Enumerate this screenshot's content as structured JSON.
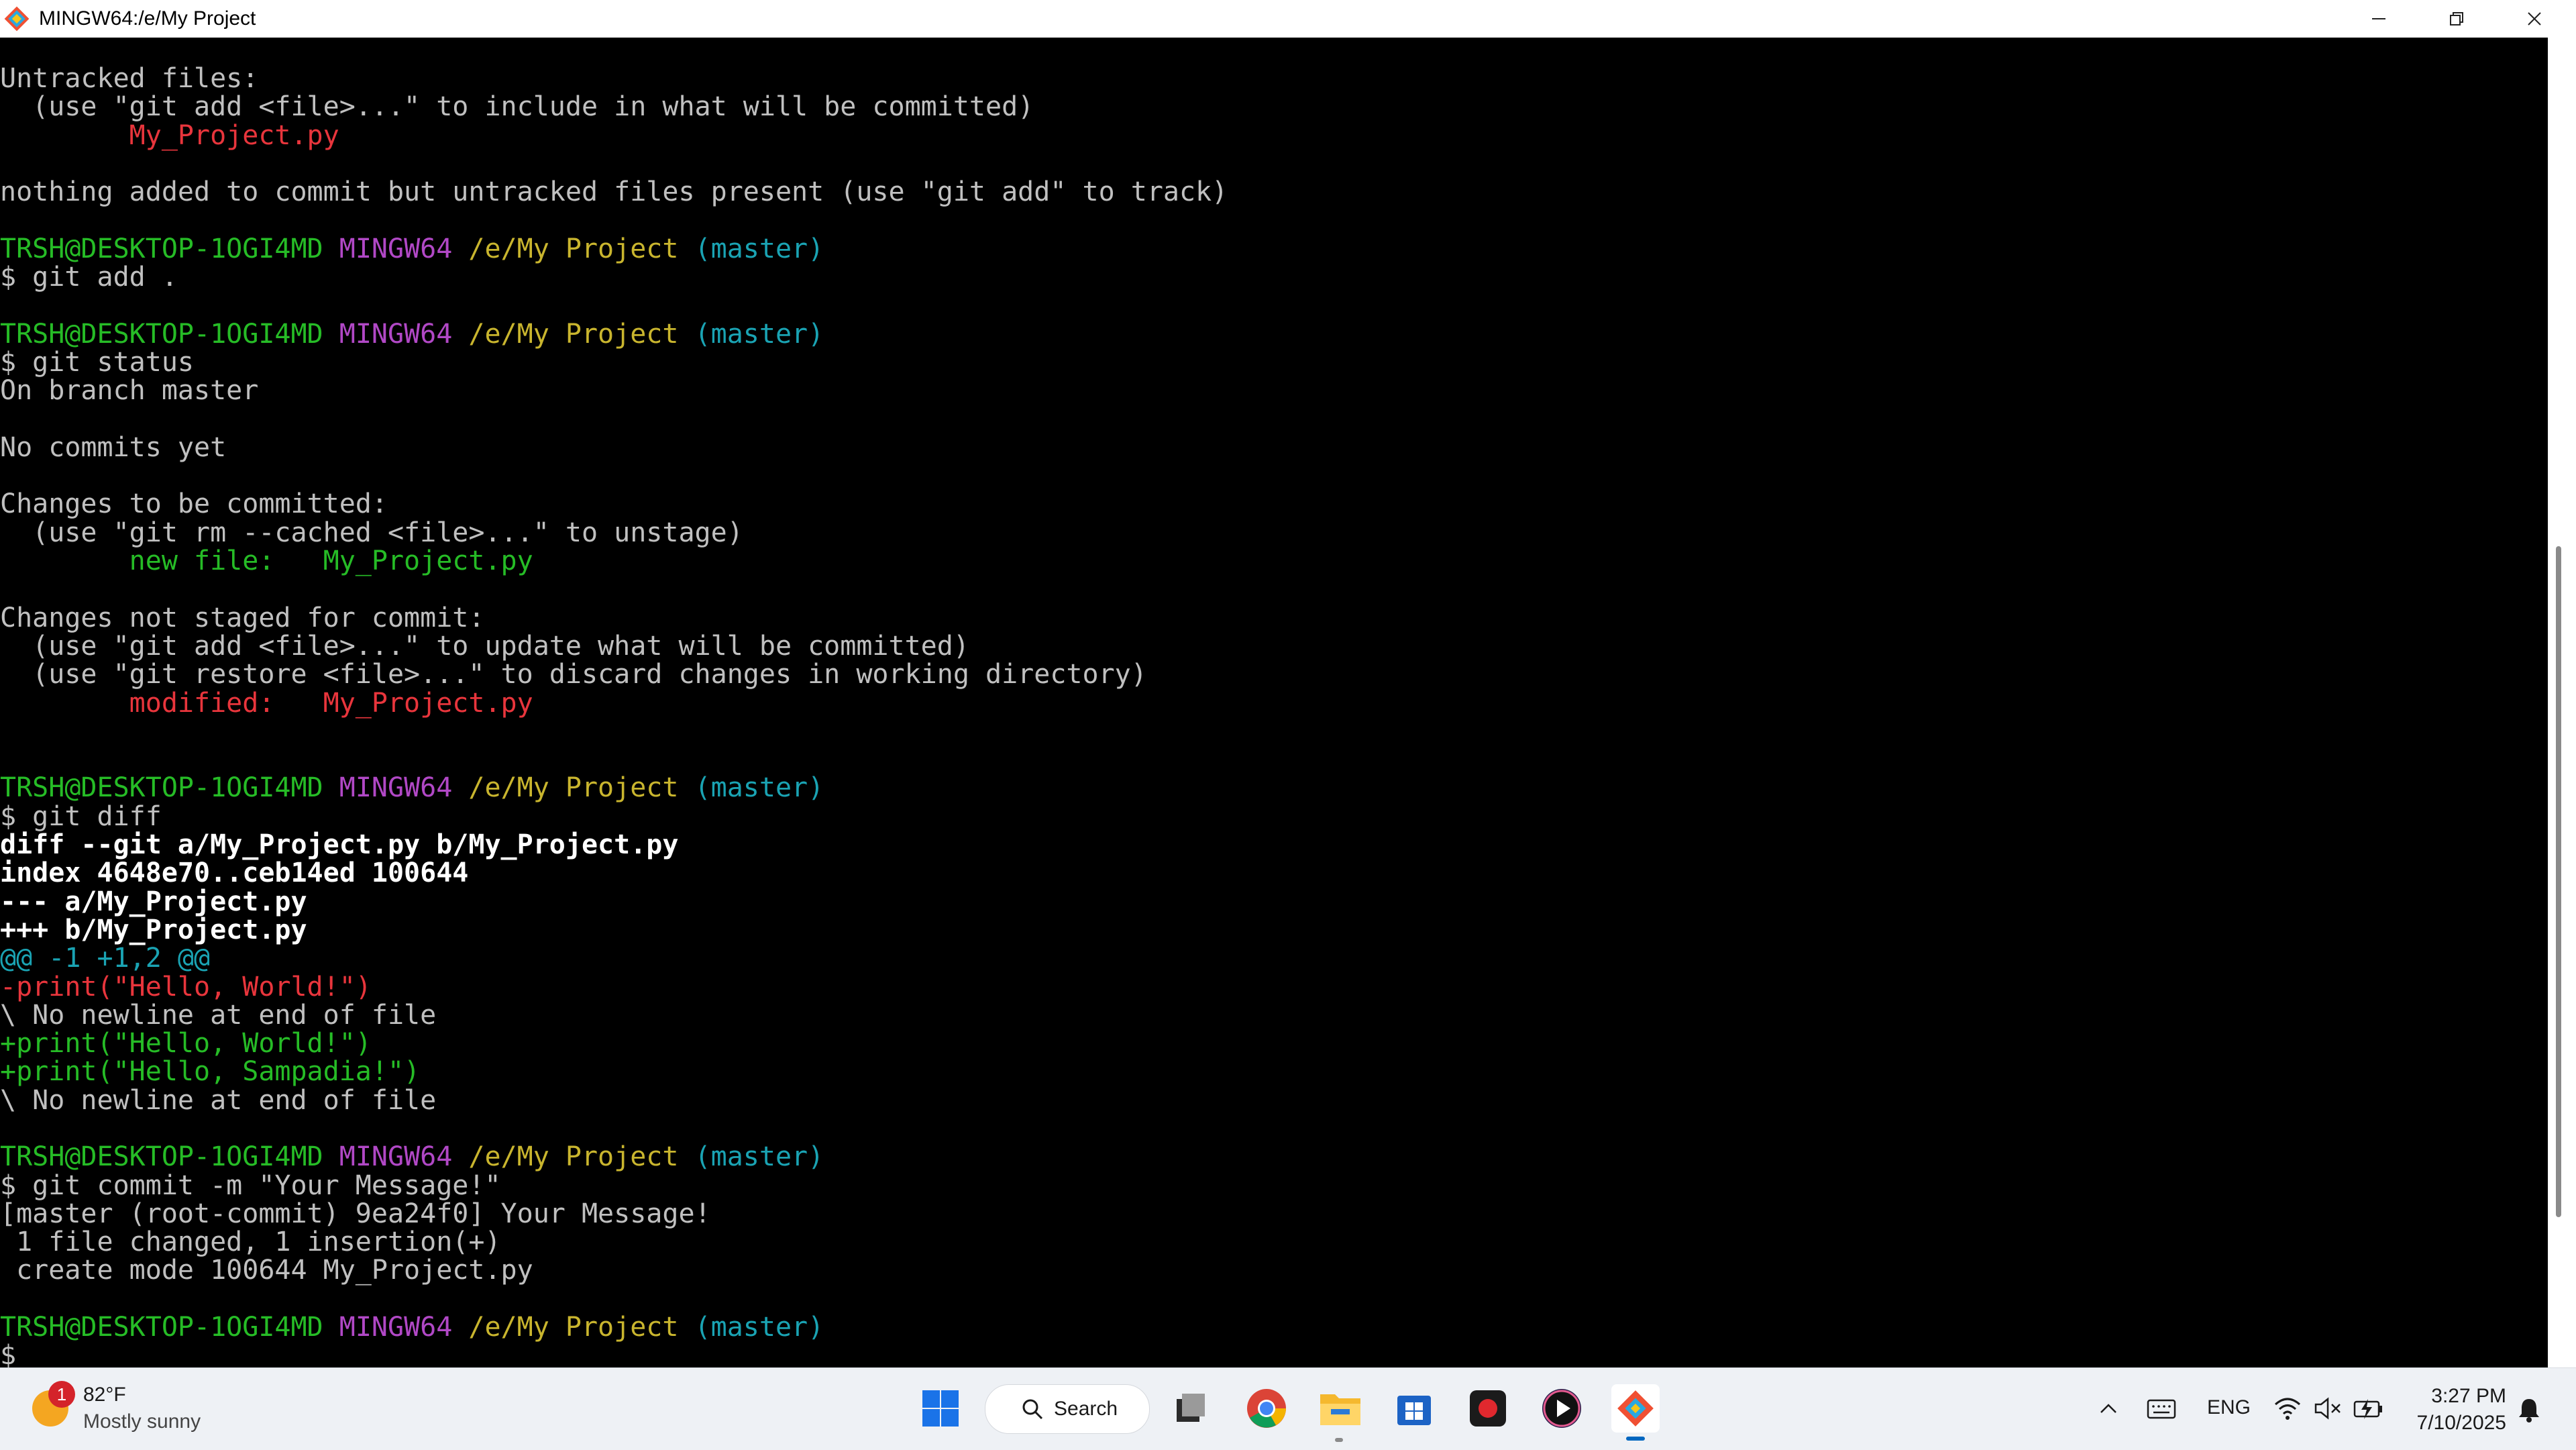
{
  "window": {
    "title": "MINGW64:/e/My Project"
  },
  "colors": {
    "green": "#26bc26",
    "red": "#e8353c",
    "magenta": "#b148c6",
    "yellow": "#c9b52e",
    "cyan": "#1aa3b3"
  },
  "terminal": {
    "lines": [
      [
        {
          "t": "Untracked files:",
          "c": "normal"
        }
      ],
      [
        {
          "t": "  (use \"git add <file>...\" to include in what will be committed)",
          "c": "normal"
        }
      ],
      [
        {
          "t": "        My_Project.py",
          "c": "red"
        }
      ],
      [],
      [
        {
          "t": "nothing added to commit but untracked files present (use \"git add\" to track)",
          "c": "normal"
        }
      ],
      [],
      [
        {
          "t": "TRSH@DESKTOP-1OGI4MD ",
          "c": "green"
        },
        {
          "t": "MINGW64 ",
          "c": "magenta"
        },
        {
          "t": "/e/My Project ",
          "c": "yellow"
        },
        {
          "t": "(master)",
          "c": "cyan"
        }
      ],
      [
        {
          "t": "$ git add .",
          "c": "normal"
        }
      ],
      [],
      [
        {
          "t": "TRSH@DESKTOP-1OGI4MD ",
          "c": "green"
        },
        {
          "t": "MINGW64 ",
          "c": "magenta"
        },
        {
          "t": "/e/My Project ",
          "c": "yellow"
        },
        {
          "t": "(master)",
          "c": "cyan"
        }
      ],
      [
        {
          "t": "$ git status",
          "c": "normal"
        }
      ],
      [
        {
          "t": "On branch master",
          "c": "normal"
        }
      ],
      [],
      [
        {
          "t": "No commits yet",
          "c": "normal"
        }
      ],
      [],
      [
        {
          "t": "Changes to be committed:",
          "c": "normal"
        }
      ],
      [
        {
          "t": "  (use \"git rm --cached <file>...\" to unstage)",
          "c": "normal"
        }
      ],
      [
        {
          "t": "        new file:   My_Project.py",
          "c": "green"
        }
      ],
      [],
      [
        {
          "t": "Changes not staged for commit:",
          "c": "normal"
        }
      ],
      [
        {
          "t": "  (use \"git add <file>...\" to update what will be committed)",
          "c": "normal"
        }
      ],
      [
        {
          "t": "  (use \"git restore <file>...\" to discard changes in working directory)",
          "c": "normal"
        }
      ],
      [
        {
          "t": "        modified:   My_Project.py",
          "c": "red"
        }
      ],
      [],
      [],
      [
        {
          "t": "TRSH@DESKTOP-1OGI4MD ",
          "c": "green"
        },
        {
          "t": "MINGW64 ",
          "c": "magenta"
        },
        {
          "t": "/e/My Project ",
          "c": "yellow"
        },
        {
          "t": "(master)",
          "c": "cyan"
        }
      ],
      [
        {
          "t": "$ git diff",
          "c": "normal"
        }
      ],
      [
        {
          "t": "diff --git a/My_Project.py b/My_Project.py",
          "c": "bold"
        }
      ],
      [
        {
          "t": "index 4648e70..ceb14ed 100644",
          "c": "bold"
        }
      ],
      [
        {
          "t": "--- a/My_Project.py",
          "c": "bold"
        }
      ],
      [
        {
          "t": "+++ b/My_Project.py",
          "c": "bold"
        }
      ],
      [
        {
          "t": "@@ -1 +1,2 @@",
          "c": "cyan"
        }
      ],
      [
        {
          "t": "-print(\"Hello, World!\")",
          "c": "red"
        }
      ],
      [
        {
          "t": "\\ No newline at end of file",
          "c": "normal"
        }
      ],
      [
        {
          "t": "+print(\"Hello, World!\")",
          "c": "green"
        }
      ],
      [
        {
          "t": "+print(\"Hello, Sampadia!\")",
          "c": "green"
        }
      ],
      [
        {
          "t": "\\ No newline at end of file",
          "c": "normal"
        }
      ],
      [],
      [
        {
          "t": "TRSH@DESKTOP-1OGI4MD ",
          "c": "green"
        },
        {
          "t": "MINGW64 ",
          "c": "magenta"
        },
        {
          "t": "/e/My Project ",
          "c": "yellow"
        },
        {
          "t": "(master)",
          "c": "cyan"
        }
      ],
      [
        {
          "t": "$ git commit -m \"Your Message!\"",
          "c": "normal"
        }
      ],
      [
        {
          "t": "[master (root-commit) 9ea24f0] Your Message!",
          "c": "normal"
        }
      ],
      [
        {
          "t": " 1 file changed, 1 insertion(+)",
          "c": "normal"
        }
      ],
      [
        {
          "t": " create mode 100644 My_Project.py",
          "c": "normal"
        }
      ],
      [],
      [
        {
          "t": "TRSH@DESKTOP-1OGI4MD ",
          "c": "green"
        },
        {
          "t": "MINGW64 ",
          "c": "magenta"
        },
        {
          "t": "/e/My Project ",
          "c": "yellow"
        },
        {
          "t": "(master)",
          "c": "cyan"
        }
      ],
      [
        {
          "t": "$",
          "c": "normal"
        }
      ]
    ],
    "scroll_position": 0.78
  },
  "taskbar": {
    "weather": {
      "temperature": "82°F",
      "condition": "Mostly sunny",
      "badge": "1"
    },
    "search_label": "Search",
    "language": "ENG",
    "time": "3:27 PM",
    "date": "7/10/2025",
    "pinned": [
      "windows-start-icon",
      "task-view-icon",
      "chrome-icon",
      "file-explorer-icon",
      "microsoft-store-icon",
      "screen-recorder-icon",
      "media-player-icon",
      "git-icon"
    ]
  }
}
